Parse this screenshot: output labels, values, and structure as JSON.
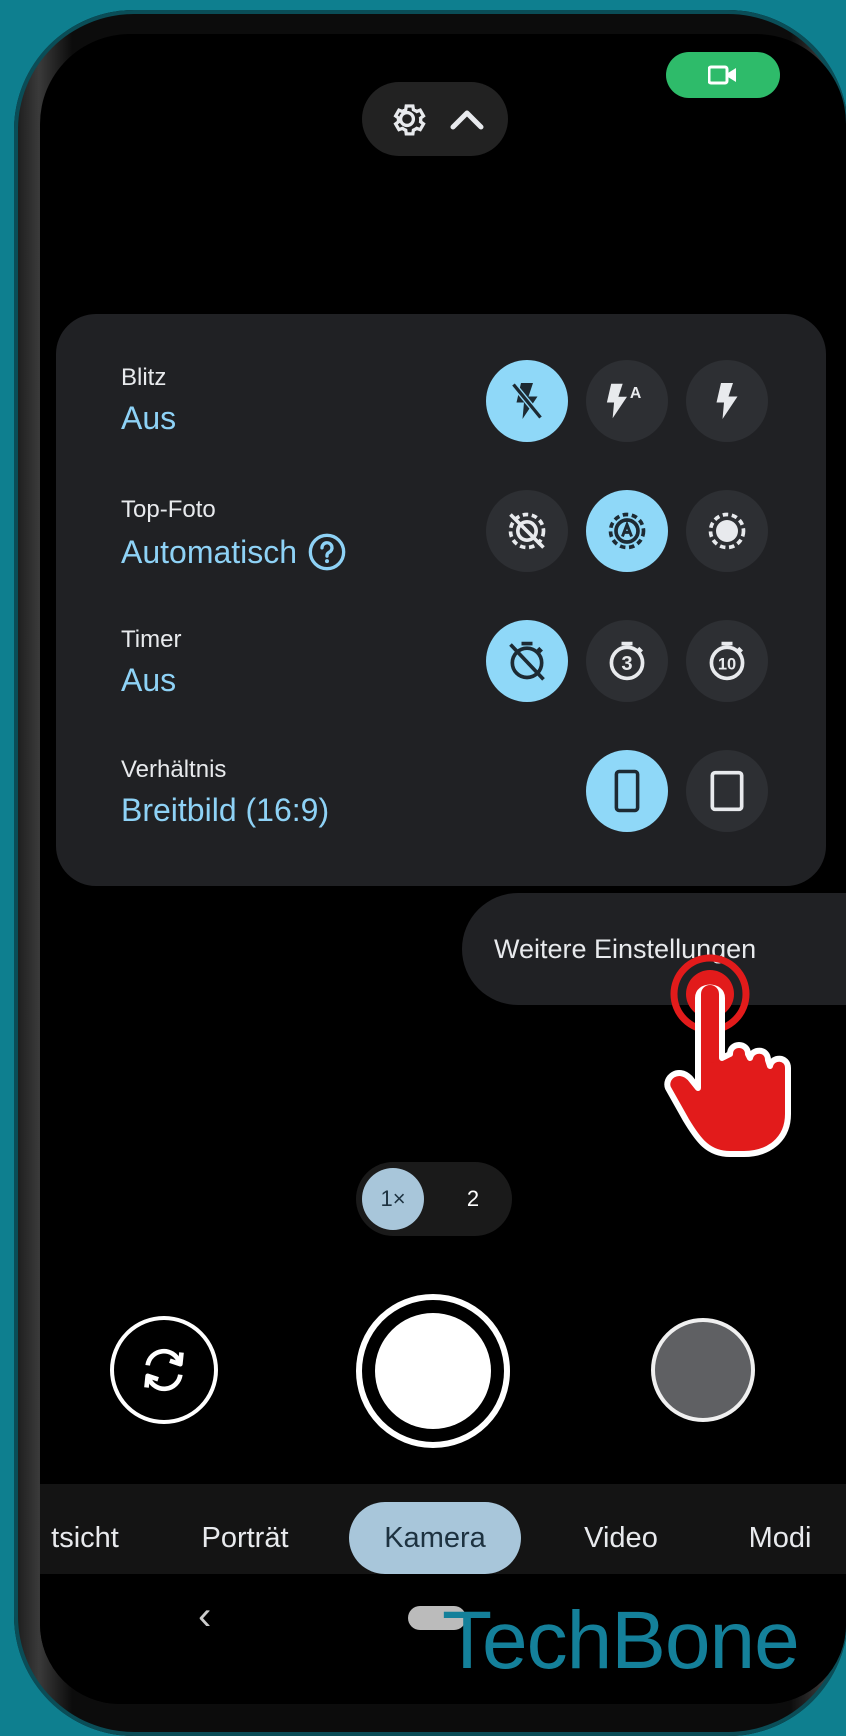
{
  "top": {
    "settings_icon": "gear-icon",
    "chevron_icon": "chevron-up-icon",
    "video_icon": "video-camera-icon"
  },
  "settings": {
    "rows": [
      {
        "label": "Blitz",
        "value": "Aus",
        "options": [
          "flash-off-icon",
          "flash-auto-icon",
          "flash-on-icon"
        ],
        "selected": 0
      },
      {
        "label": "Top-Foto",
        "value": "Automatisch",
        "help_icon": "help-circle-icon",
        "options": [
          "top-shot-off-icon",
          "top-shot-auto-icon",
          "top-shot-on-icon"
        ],
        "selected": 1
      },
      {
        "label": "Timer",
        "value": "Aus",
        "options": [
          "timer-off-icon",
          "timer-3-icon",
          "timer-10-icon"
        ],
        "selected": 0
      },
      {
        "label": "Verhältnis",
        "value": "Breitbild (16:9)",
        "options": [
          "aspect-16-9-icon",
          "aspect-4-3-icon"
        ],
        "selected": 0
      }
    ],
    "timer_3_label": "3",
    "timer_10_label": "10",
    "flash_auto_label": "A"
  },
  "more_settings": {
    "label": "Weitere Einstellungen"
  },
  "zoom": {
    "options": [
      "1×",
      "2"
    ],
    "selected": 0
  },
  "camera_controls": {
    "flip_icon": "switch-camera-icon",
    "shutter": "shutter-button",
    "gallery": "gallery-thumbnail"
  },
  "modes": {
    "items": [
      "tsicht",
      "Porträt",
      "Kamera",
      "Video",
      "Modi"
    ],
    "selected": 2
  },
  "nav": {
    "back_icon": "chevron-left-icon",
    "back_glyph": "‹"
  },
  "watermark": {
    "text": "TechBone"
  },
  "colors": {
    "accent": "#8fd8f8",
    "accent_text": "#8ed2f6",
    "panel": "#202124",
    "video_pill": "#2ebb6a",
    "watermark": "#14809a",
    "pointer": "#e21b1b"
  }
}
